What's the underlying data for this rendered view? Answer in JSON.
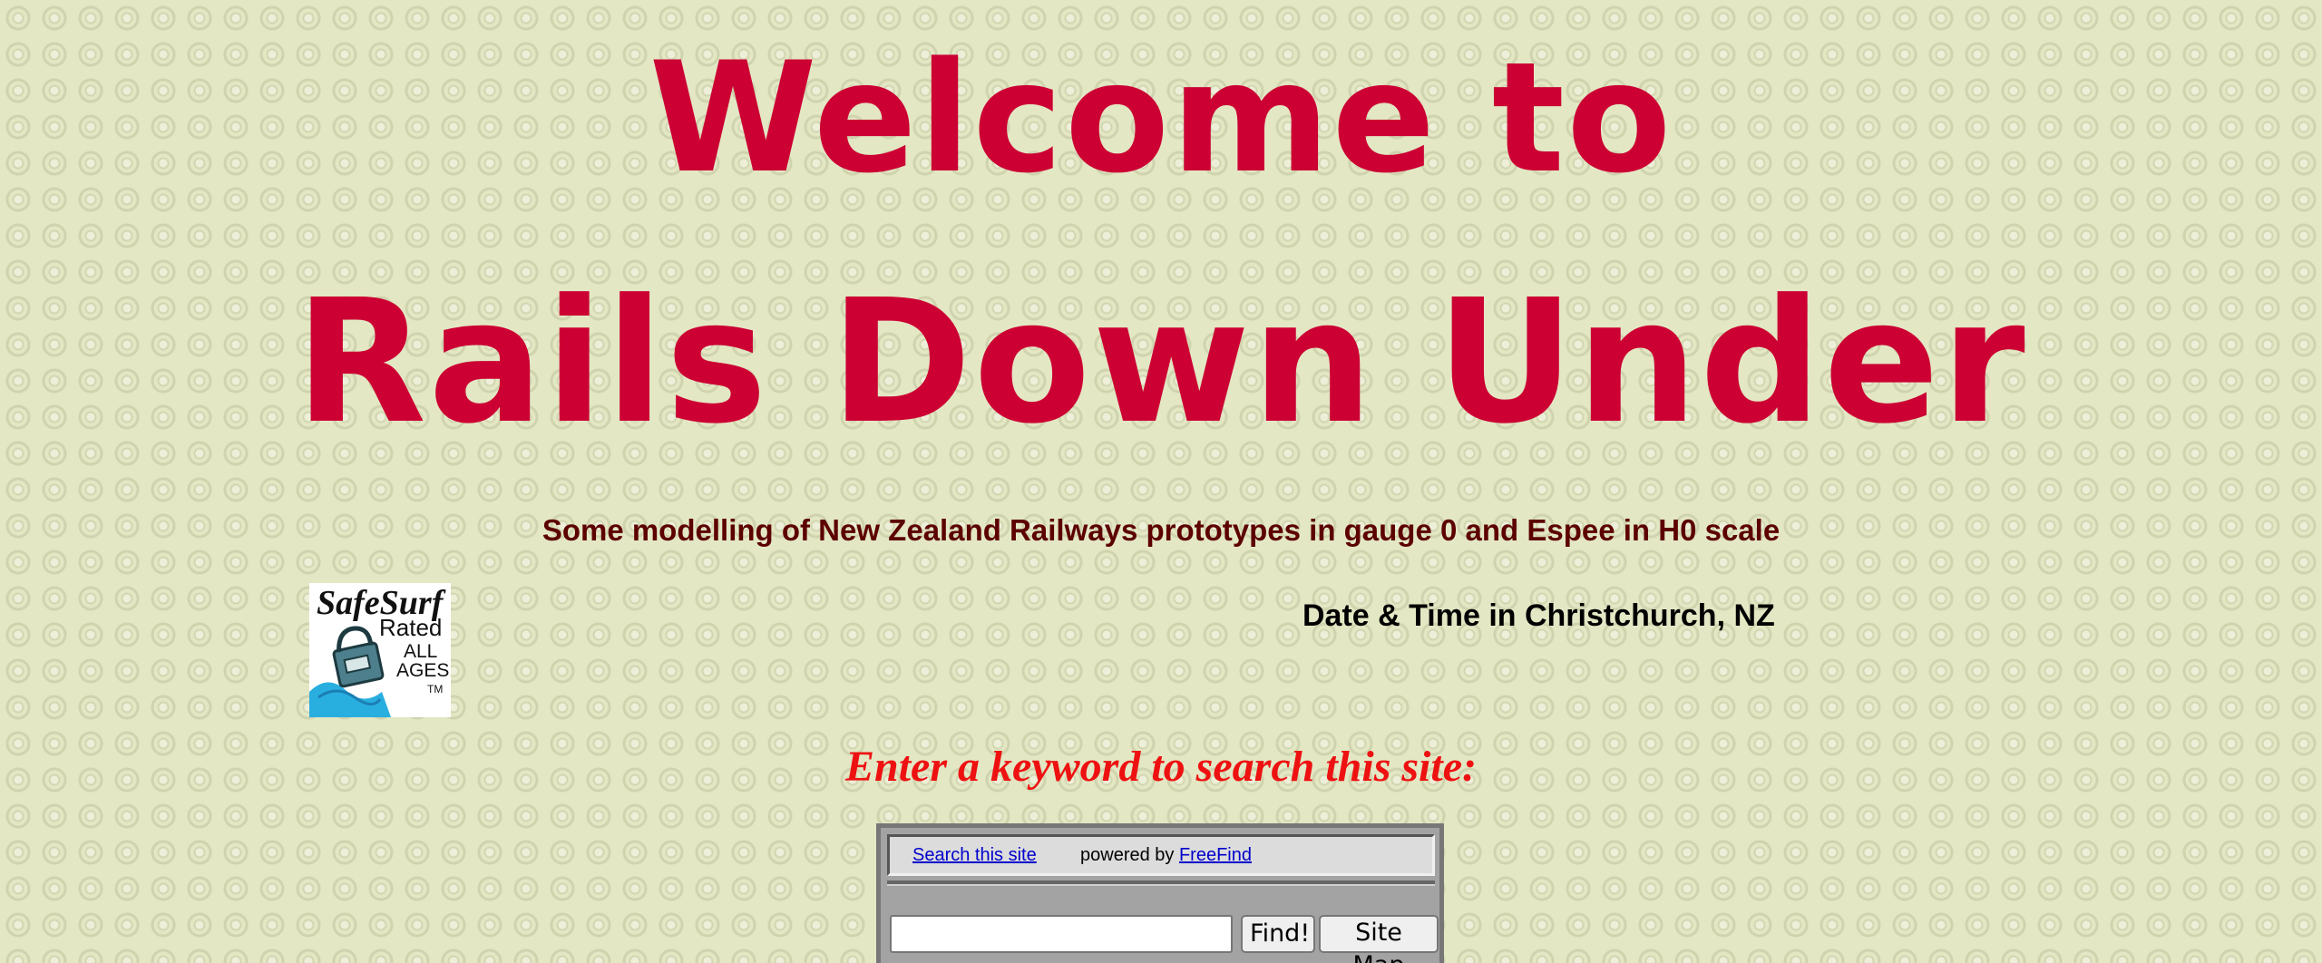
{
  "header": {
    "title_line1": "Welcome to",
    "title_line2": "Rails Down Under",
    "tagline": "Some modelling of New Zealand Railways prototypes in gauge 0 and Espee in H0 scale"
  },
  "badge": {
    "line1": "SafeSurf",
    "line2": "Rated",
    "line3": "ALL",
    "line4": "AGES",
    "tm": "TM"
  },
  "datetime": {
    "label": "Date & Time in Christchurch, NZ"
  },
  "search": {
    "heading": "Enter a keyword to search this site:",
    "search_link": "Search this site",
    "powered_by": "powered by",
    "powered_link": "FreeFind",
    "input_value": "",
    "find_label": "Find!",
    "sitemap_label": "Site Map"
  },
  "colors": {
    "title": "#cc0033",
    "tagline": "#5c0000",
    "search_heading": "#ee1111",
    "background": "#e3e7c4"
  }
}
